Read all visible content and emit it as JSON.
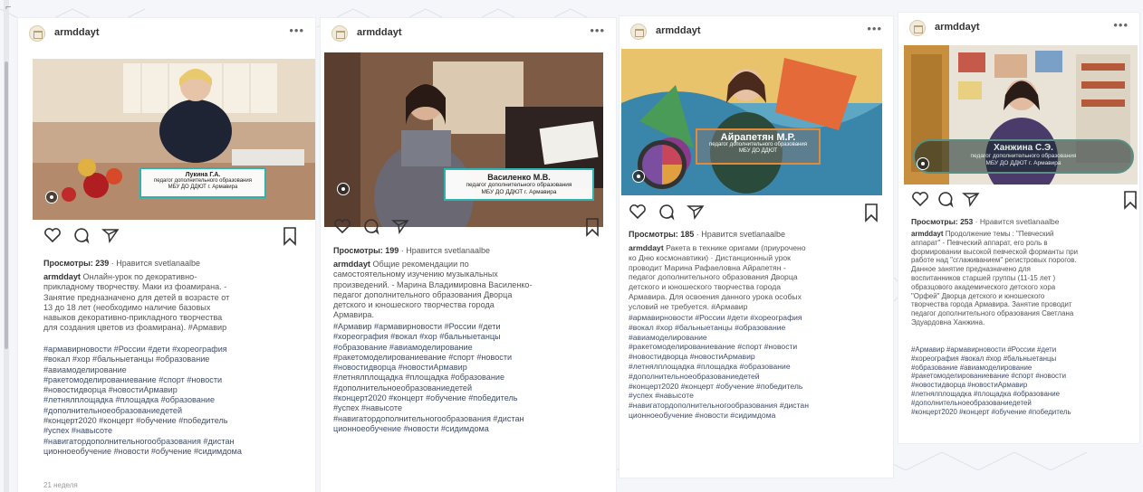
{
  "window": {
    "corner_glyph": "⌐"
  },
  "posts": [
    {
      "username": "armddayt",
      "more": "•••",
      "media_label": "Лукина Г.А.",
      "media_sub": "педагог дополнительного образования\nМБУ ДО ДДЮТ г. Армавира",
      "views": "Просмотры: 239",
      "likes": "· Нравится svetlanaalbe",
      "caption_user": "armddayt",
      "caption_text": " Онлайн-урок по декоративно-\nприкладному творчеству. Маки из фоамирана. -\nЗанятие предназначено для детей в возрасте от\n13 до 18 лет (необходимо наличие базовых\nнавыков декоративно-прикладного творчества\nдля создания цветов из фоамирана). #Армавир",
      "tags": "#армавирновости #России #дети #хореография\n#вокал #хор #бальныетанцы #образование\n#авиамоделирование\n#ракетомоделированиевание #спорт #новости\n#новостидворца #новостиАрмавир\n#летнялплощадка #площадка #образование\n#дополнительноеобразованиедетей\n#концерт2020 #концерт #обучение #победитель\n#успех #навысоте\n#навигатордополнительногообразования #дистан\nционноеобучение #новости #обучение #сидимдома",
      "comments": "21 неделя"
    },
    {
      "username": "armddayt",
      "more": "•••",
      "media_label": "Василенко М.В.",
      "media_sub": "педагог дополнительного образования\nМБУ ДО ДДЮТ г. Армавира",
      "views": "Просмотры: 199",
      "likes": "· Нравится svetlanaalbe",
      "caption_user": "armddayt",
      "caption_text": " Общие рекомендации по\nсамостоятельному изучению музыкальных\nпроизведений. - Марина Владимировна Василенко-\nпедагог дополнительного образования Дворца\nдетского и юношеского творчества города\nАрмавира.",
      "tags": "#Армавир #армавирновости #России #дети\n#хореография #вокал #хор #бальныетанцы\n#образование #авиамоделирование\n#ракетомоделированиевание #спорт #новости\n#новостидворца #новостиАрмавир\n#летнялплощадка #площадка #образование\n#дополнительноеобразованиедетей\n#концерт2020 #концерт #обучение #победитель\n#успех #навысоте\n#навигатордополнительногообразования #дистан\nционноеобучение #новости #сидимдома",
      "comments": ""
    },
    {
      "username": "armddayt",
      "more": "•••",
      "media_label": "Айрапетян М.Р.",
      "media_sub": "педагог дополнительного образования\nМБУ ДО ДДЮТ",
      "views": "Просмотры: 185",
      "likes": "· Нравится svetlanaalbe",
      "caption_user": "armddayt",
      "caption_text": " Ракета в технике оригами (приурочено\nко Дню космонавтики) · Дистанционный урок\nпроводит Марина Рафаеловна Айрапетян -\nпедагог дополнительного образования Дворца\nдетского и юношеского творчества города\nАрмавира. Для освоения данного урока особых\nусловий не требуется. #Армавир",
      "tags": "#армавирновости #России #дети #хореография\n#вокал #хор #бальныетанцы #образование\n#авиамоделирование\n#ракетомоделированиевание #спорт #новости\n#новостидворца #новостиАрмавир\n#летнялплощадка #площадка #образование\n#дополнительноеобразованиедетей\n#концерт2020 #концерт #обучение #победитель\n#успех #навысоте\n#навигатордополнительногообразования #дистан\nционноеобучение #новости #сидимдома",
      "comments": ""
    },
    {
      "username": "armddayt",
      "more": "•••",
      "media_label": "Ханжина С.Э.",
      "media_sub": "педагог дополнительного образования\nМБУ ДО ДДЮТ г. Армавира",
      "views": "Просмотры: 253",
      "likes": "· Нравится svetlanaalbe",
      "caption_user": "armddayt",
      "caption_text": " Продолжение темы : \"Певческий\nаппарат\" - Певческий аппарат, его роль в\nформировании высокой певческой форманты при\nработе над \"сглаживанием\" регистровых порогов.\nДанное занятие предназначено для\nвоспитанников старшей группы (11-15 лет )\nобразцового академического детского хора\n\"Орфей\" Дворца детского и юношеского\nтворчества города Армавира. Занятие проводит\nпедагог дополнительного образования Светлана\nЭдуардовна Ханжина.",
      "tags": "#Армавир #армавирновости #России #дети\n#хореография #вокал #хор #бальныетанцы\n#образование #авиамоделирование\n#ракетомоделированиевание #спорт #новости\n#новостидворца #новостиАрмавир\n#летнялплощадка #площадка #образование\n#дополнительноеобразованиедетей\n#концерт2020 #концерт #обучение #победитель",
      "comments": ""
    }
  ]
}
